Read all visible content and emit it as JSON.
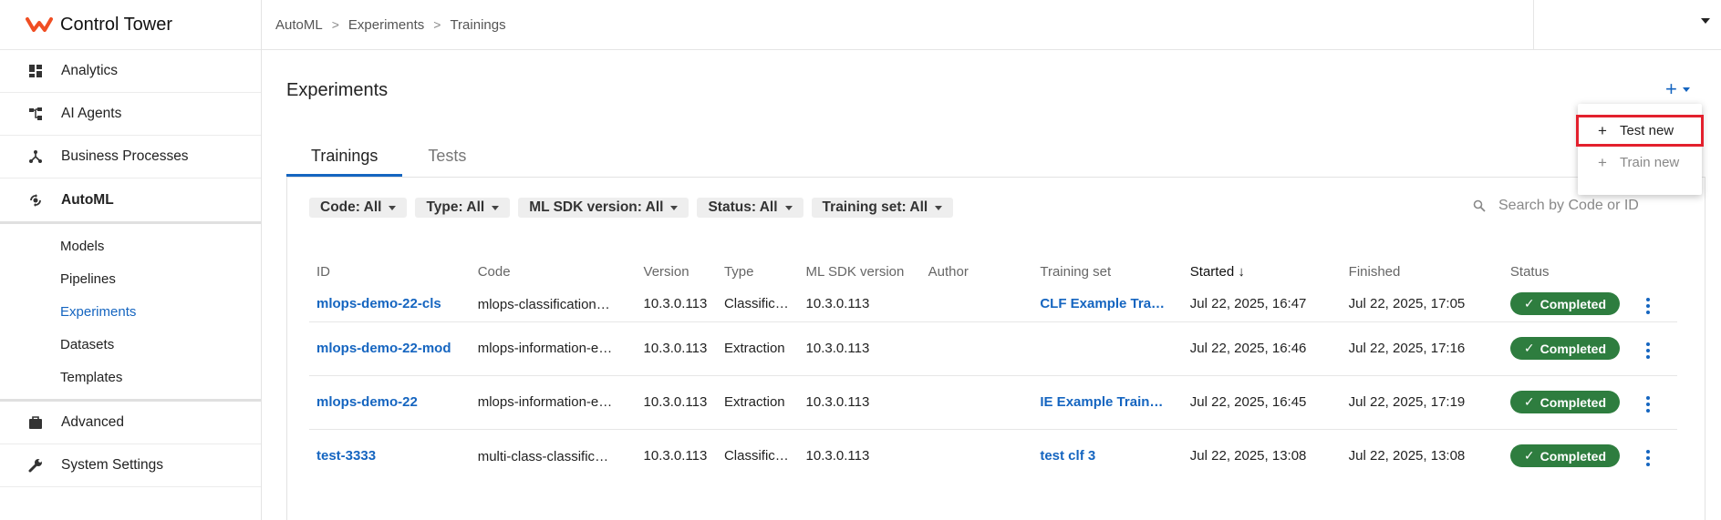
{
  "app": {
    "title": "Control Tower"
  },
  "sidebar": {
    "items": [
      {
        "label": "Analytics",
        "icon": "dashboard-icon"
      },
      {
        "label": "AI Agents",
        "icon": "ai-agents-icon"
      },
      {
        "label": "Business Processes",
        "icon": "process-icon"
      },
      {
        "label": "AutoML",
        "icon": "automl-icon"
      }
    ],
    "automl_sub": [
      "Models",
      "Pipelines",
      "Experiments",
      "Datasets",
      "Templates"
    ],
    "bottom_items": [
      {
        "label": "Advanced",
        "icon": "briefcase-icon"
      },
      {
        "label": "System Settings",
        "icon": "wrench-icon"
      }
    ]
  },
  "breadcrumb": [
    "AutoML",
    "Experiments",
    "Trainings"
  ],
  "page": {
    "title": "Experiments"
  },
  "tabs": [
    "Trainings",
    "Tests"
  ],
  "filters": [
    "Code: All",
    "Type: All",
    "ML SDK version: All",
    "Status: All",
    "Training set: All"
  ],
  "search": {
    "placeholder": "Search by Code or ID"
  },
  "menu": {
    "items": [
      "Test new",
      "Train new"
    ]
  },
  "table": {
    "headers": [
      "ID",
      "Code",
      "Version",
      "Type",
      "ML SDK version",
      "Author",
      "Training set",
      "Started",
      "Finished",
      "Status"
    ],
    "rows": [
      [
        "mlops-demo-22-cls",
        "mlops-classification-pipe…",
        "10.3.0.113",
        "Classific…",
        "10.3.0.113",
        "",
        "CLF Example Tra…",
        "Jul 22, 2025, 16:47",
        "Jul 22, 2025, 17:05",
        "Completed"
      ],
      [
        "mlops-demo-22-mod",
        "mlops-information-extrac…",
        "10.3.0.113",
        "Extraction",
        "10.3.0.113",
        "",
        "",
        "Jul 22, 2025, 16:46",
        "Jul 22, 2025, 17:16",
        "Completed"
      ],
      [
        "mlops-demo-22",
        "mlops-information-extrac…",
        "10.3.0.113",
        "Extraction",
        "10.3.0.113",
        "",
        "IE Example Train…",
        "Jul 22, 2025, 16:45",
        "Jul 22, 2025, 17:19",
        "Completed"
      ],
      [
        "test-3333",
        "multi-class-classification…",
        "10.3.0.113",
        "Classific…",
        "10.3.0.113",
        "",
        "test clf 3",
        "Jul 22, 2025, 13:08",
        "Jul 22, 2025, 13:08",
        "Completed"
      ]
    ]
  },
  "colors": {
    "accent": "#1565c0",
    "brand": "#f04e23",
    "success": "#2e7d3f",
    "highlight": "#e3202d"
  }
}
